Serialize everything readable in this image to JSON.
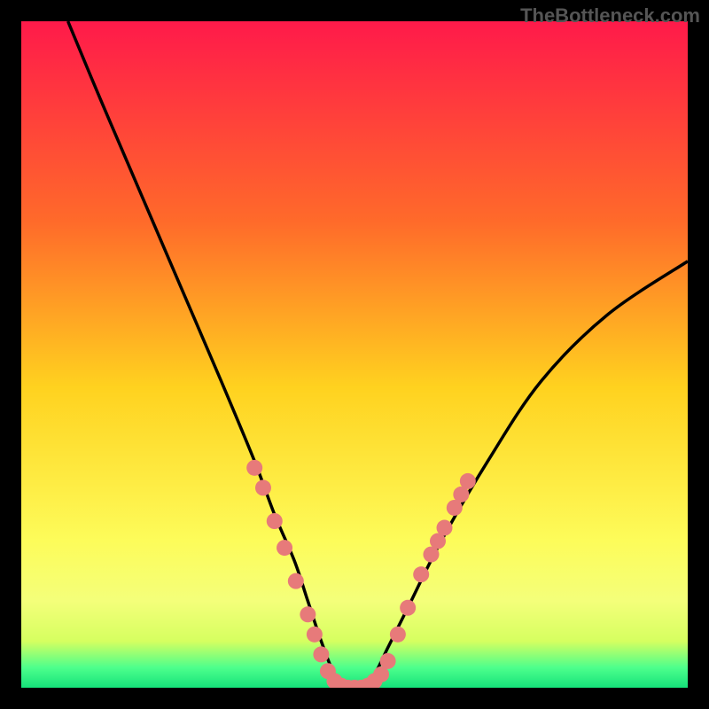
{
  "watermark": "TheBottleneck.com",
  "chart_data": {
    "type": "line",
    "title": "",
    "xlabel": "",
    "ylabel": "",
    "xlim": [
      0,
      100
    ],
    "ylim": [
      0,
      100
    ],
    "gradient_stops": [
      {
        "offset": 0,
        "color": "#ff1a4a"
      },
      {
        "offset": 30,
        "color": "#ff6a2a"
      },
      {
        "offset": 55,
        "color": "#ffd21f"
      },
      {
        "offset": 78,
        "color": "#fdfc5a"
      },
      {
        "offset": 87,
        "color": "#f4ff7a"
      },
      {
        "offset": 93,
        "color": "#d6ff60"
      },
      {
        "offset": 97,
        "color": "#4dff8c"
      },
      {
        "offset": 100,
        "color": "#15e27a"
      }
    ],
    "series": [
      {
        "name": "curve",
        "x": [
          7,
          12,
          18,
          24,
          30,
          35,
          38,
          41,
          43,
          45,
          47,
          49,
          51,
          53,
          55,
          58,
          63,
          70,
          78,
          88,
          100
        ],
        "y": [
          100,
          88,
          74,
          60,
          46,
          34,
          26,
          19,
          13,
          7,
          2,
          0,
          0,
          2,
          6,
          12,
          22,
          34,
          46,
          56,
          64
        ]
      }
    ],
    "markers": {
      "name": "dots",
      "color": "#e77a7a",
      "points": [
        {
          "x": 35.0,
          "y": 33
        },
        {
          "x": 36.3,
          "y": 30
        },
        {
          "x": 38.0,
          "y": 25
        },
        {
          "x": 39.5,
          "y": 21
        },
        {
          "x": 41.2,
          "y": 16
        },
        {
          "x": 43.0,
          "y": 11
        },
        {
          "x": 44.0,
          "y": 8
        },
        {
          "x": 45.0,
          "y": 5
        },
        {
          "x": 46.0,
          "y": 2.5
        },
        {
          "x": 47.0,
          "y": 1
        },
        {
          "x": 48.0,
          "y": 0.3
        },
        {
          "x": 49.0,
          "y": 0
        },
        {
          "x": 50.0,
          "y": 0
        },
        {
          "x": 51.0,
          "y": 0
        },
        {
          "x": 52.0,
          "y": 0.3
        },
        {
          "x": 53.0,
          "y": 1
        },
        {
          "x": 54.0,
          "y": 2
        },
        {
          "x": 55.0,
          "y": 4
        },
        {
          "x": 56.5,
          "y": 8
        },
        {
          "x": 58.0,
          "y": 12
        },
        {
          "x": 60.0,
          "y": 17
        },
        {
          "x": 61.5,
          "y": 20
        },
        {
          "x": 62.5,
          "y": 22
        },
        {
          "x": 63.5,
          "y": 24
        },
        {
          "x": 65.0,
          "y": 27
        },
        {
          "x": 66.0,
          "y": 29
        },
        {
          "x": 67.0,
          "y": 31
        }
      ]
    }
  }
}
